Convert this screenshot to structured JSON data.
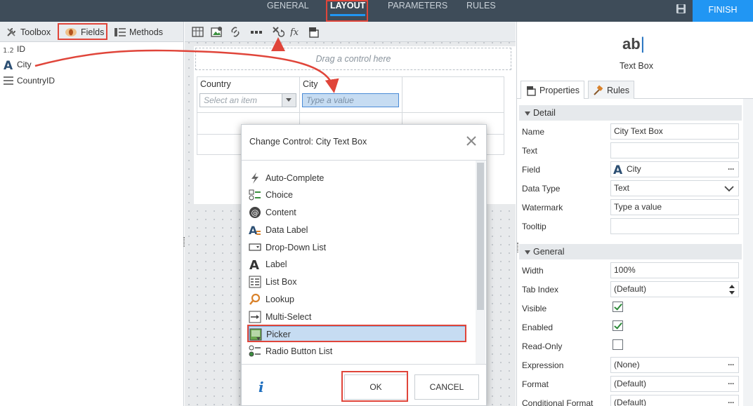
{
  "topnav": {
    "tabs": [
      "GENERAL",
      "LAYOUT",
      "PARAMETERS",
      "RULES"
    ],
    "finish": "FINISH"
  },
  "left": {
    "tabs": [
      "Toolbox",
      "Fields",
      "Methods"
    ],
    "fields": [
      "ID",
      "City",
      "CountryID"
    ]
  },
  "canvas": {
    "dropzone": "Drag a control here",
    "col1": "Country",
    "col2": "City",
    "select_placeholder": "Select an item",
    "textbox_placeholder": "Type a value"
  },
  "dialog": {
    "title": "Change Control: City Text Box",
    "items": [
      "Auto-Complete",
      "Choice",
      "Content",
      "Data Label",
      "Drop-Down List",
      "Label",
      "List Box",
      "Lookup",
      "Multi-Select",
      "Picker",
      "Radio Button List"
    ],
    "selected": "Picker",
    "ok": "OK",
    "cancel": "CANCEL",
    "info": "i"
  },
  "right": {
    "icon_text": "ab",
    "control_name": "Text Box",
    "tabs": [
      "Properties",
      "Rules"
    ],
    "sections": [
      "Detail",
      "General"
    ],
    "detail": [
      {
        "label": "Name",
        "value": "City Text Box"
      },
      {
        "label": "Text",
        "value": ""
      },
      {
        "label": "Field",
        "value": "City"
      },
      {
        "label": "Data Type",
        "value": "Text"
      },
      {
        "label": "Watermark",
        "value": "Type a value"
      },
      {
        "label": "Tooltip",
        "value": ""
      }
    ],
    "general": [
      {
        "label": "Width",
        "value": "100%"
      },
      {
        "label": "Tab Index",
        "value": "(Default)"
      },
      {
        "label": "Visible",
        "value": ""
      },
      {
        "label": "Enabled",
        "value": ""
      },
      {
        "label": "Read-Only",
        "value": ""
      },
      {
        "label": "Expression",
        "value": "(None)"
      },
      {
        "label": "Format",
        "value": "(Default)"
      },
      {
        "label": "Conditional Format",
        "value": "(Default)"
      }
    ],
    "checks": {
      "visible": true,
      "enabled": true,
      "read_only": false
    }
  },
  "colors": {
    "accent": "#2196f3",
    "topbar": "#3e4c59",
    "highlight": "#e0453a"
  }
}
